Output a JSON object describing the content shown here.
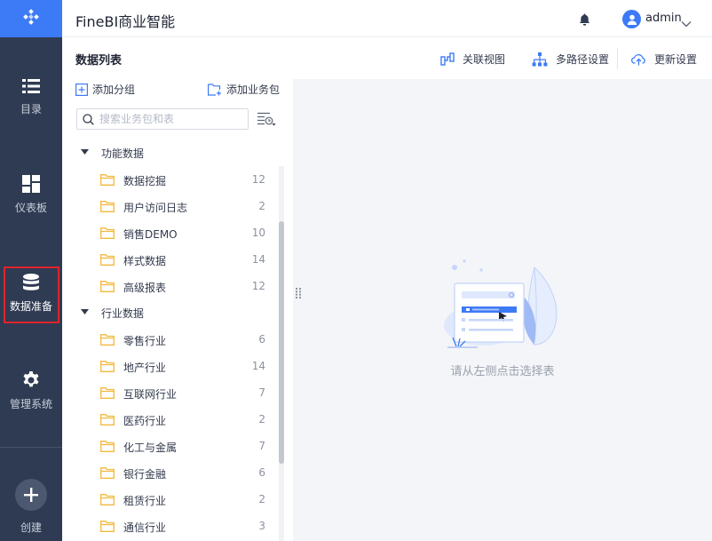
{
  "app": {
    "title": "FineBI商业智能",
    "user": "admin"
  },
  "nav": {
    "items": [
      {
        "label": "目录",
        "icon": "list-icon"
      },
      {
        "label": "仪表板",
        "icon": "dashboard-icon"
      },
      {
        "label": "数据准备",
        "icon": "database-icon",
        "active": true
      },
      {
        "label": "管理系统",
        "icon": "gear-icon"
      },
      {
        "label": "创建",
        "icon": "plus-icon"
      }
    ]
  },
  "header": {
    "section_title": "数据列表",
    "actions": [
      {
        "label": "关联视图",
        "icon": "relation-icon"
      },
      {
        "label": "多路径设置",
        "icon": "hierarchy-icon"
      },
      {
        "label": "更新设置",
        "icon": "cloud-update-icon"
      }
    ]
  },
  "panel": {
    "add_group": "添加分组",
    "add_package": "添加业务包",
    "search_placeholder": "搜索业务包和表",
    "groups": [
      {
        "name": "功能数据",
        "expanded": true,
        "packages": [
          {
            "name": "数据挖掘",
            "count": "12"
          },
          {
            "name": "用户访问日志",
            "count": "2"
          },
          {
            "name": "销售DEMO",
            "count": "10"
          },
          {
            "name": "样式数据",
            "count": "14"
          },
          {
            "name": "高级报表",
            "count": "12"
          }
        ]
      },
      {
        "name": "行业数据",
        "expanded": true,
        "packages": [
          {
            "name": "零售行业",
            "count": "6"
          },
          {
            "name": "地产行业",
            "count": "14"
          },
          {
            "name": "互联网行业",
            "count": "7"
          },
          {
            "name": "医药行业",
            "count": "2"
          },
          {
            "name": "化工与金属",
            "count": "7"
          },
          {
            "name": "银行金融",
            "count": "6"
          },
          {
            "name": "租赁行业",
            "count": "2"
          },
          {
            "name": "通信行业",
            "count": "3"
          }
        ]
      }
    ]
  },
  "main": {
    "empty_text": "请从左侧点击选择表"
  },
  "colors": {
    "brand": "#3d7af6",
    "nav_bg": "#2f3b52",
    "folder": "#f3b93d",
    "highlight_box": "#e0242b",
    "content_bg": "#f4f5f8"
  }
}
